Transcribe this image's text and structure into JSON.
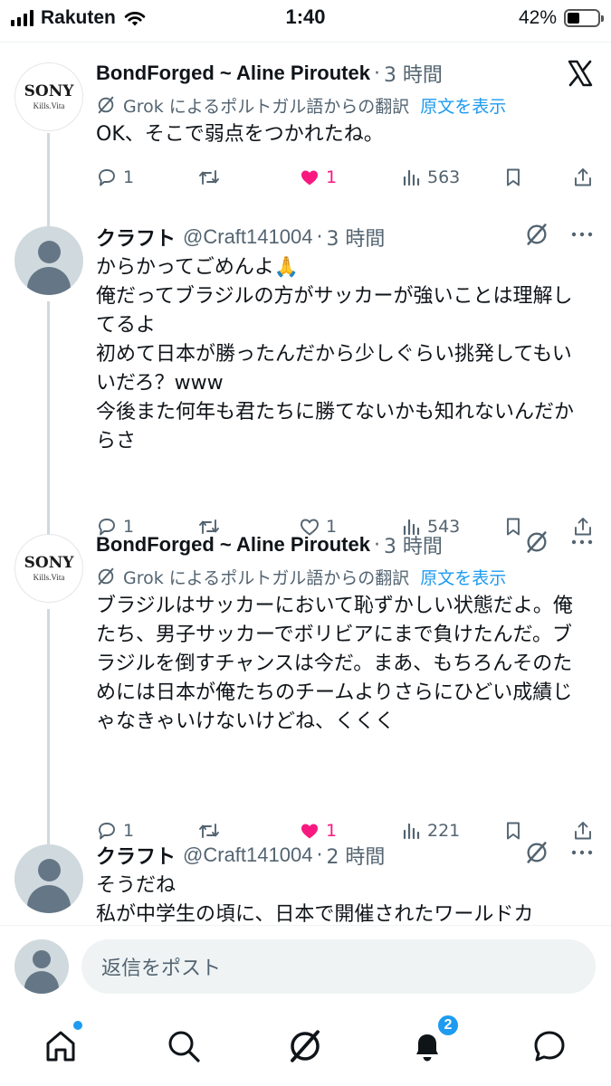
{
  "status_bar": {
    "carrier": "Rakuten",
    "time": "1:40",
    "battery": "42%",
    "battery_level": 0.42
  },
  "posts": [
    {
      "avatar": "sony-logo",
      "logo_text": "SONY",
      "logo_sub": "Kills.Vita",
      "name": "BondForged ~ Aline Piroutek",
      "handle": "",
      "time": "3 時間",
      "translation_note": "Grok によるポルトガル語からの翻訳",
      "show_original": "原文を表示",
      "text": "OK、そこで弱点をつかれたね。",
      "replies": "1",
      "reposts": "",
      "likes": "1",
      "liked": true,
      "views": "563"
    },
    {
      "avatar": "default",
      "name": "クラフト",
      "handle": "@Craft141004",
      "time": "3 時間",
      "text": "からかってごめんよ🙏\n俺だってブラジルの方がサッカーが強いことは理解してるよ\n初めて日本が勝ったんだから少しぐらい挑発してもいいだろ？www\n今後また何年も君たちに勝てないかも知れないんだからさ",
      "replies": "1",
      "reposts": "",
      "likes": "1",
      "liked": false,
      "views": "543"
    },
    {
      "avatar": "sony-logo",
      "logo_text": "SONY",
      "logo_sub": "Kills.Vita",
      "name": "BondForged ~ Aline Piroutek",
      "handle": "",
      "time": "3 時間",
      "translation_note": "Grok によるポルトガル語からの翻訳",
      "show_original": "原文を表示",
      "text": "ブラジルはサッカーにおいて恥ずかしい状態だよ。俺たち、男子サッカーでボリビアにまで負けたんだ。ブラジルを倒すチャンスは今だ。まあ、もちろんそのためには日本が俺たちのチームよりさらにひどい成績じゃなきゃいけないけどね、くくく",
      "replies": "1",
      "reposts": "",
      "likes": "1",
      "liked": true,
      "views": "221"
    },
    {
      "avatar": "default",
      "name": "クラフト",
      "handle": "@Craft141004",
      "time": "2 時間",
      "text": "そうだね\n私が中学生の頃に、日本で開催されたワールドカ",
      "replies": "",
      "reposts": "",
      "likes": "",
      "liked": false,
      "views": ""
    }
  ],
  "reply_bar": {
    "placeholder": "返信をポスト"
  },
  "tab_bar": {
    "notifications_badge": "2"
  },
  "colors": {
    "accent": "#1d9bf0",
    "like": "#f91880",
    "muted": "#536471"
  }
}
